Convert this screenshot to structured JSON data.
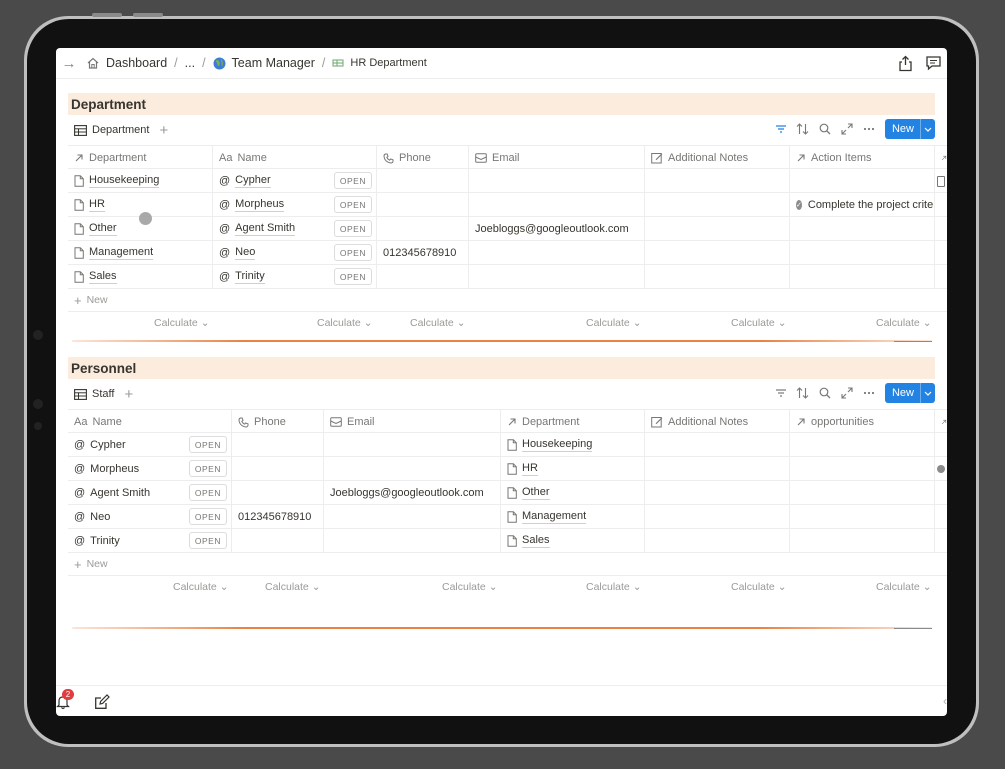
{
  "breadcrumb": {
    "items": [
      "Dashboard",
      "...",
      "Team Manager",
      "HR Department"
    ],
    "separator": "/"
  },
  "colors": {
    "accent": "#2383e2",
    "section_header_bg": "#fbecdd",
    "divider": "#e88344",
    "badge": "#e03e3e"
  },
  "department_section": {
    "title": "Department",
    "view_tab": "Department",
    "new_label": "New",
    "columns": [
      "Department",
      "Name",
      "Phone",
      "Email",
      "Additional Notes",
      "Action Items"
    ],
    "rows": [
      {
        "department": "Housekeeping",
        "name": "Cypher",
        "phone": "",
        "email": "",
        "notes": "",
        "action": ""
      },
      {
        "department": "HR",
        "name": "Morpheus",
        "phone": "",
        "email": "",
        "notes": "",
        "action": "Complete the project criteria"
      },
      {
        "department": "Other",
        "name": "Agent Smith",
        "phone": "",
        "email": "Joebloggs@googleoutlook.com",
        "notes": "",
        "action": ""
      },
      {
        "department": "Management",
        "name": "Neo",
        "phone": "012345678910",
        "email": "",
        "notes": "",
        "action": ""
      },
      {
        "department": "Sales",
        "name": "Trinity",
        "phone": "",
        "email": "",
        "notes": "",
        "action": ""
      }
    ],
    "open_label": "OPEN",
    "add_row_label": "New",
    "calculate_label": "Calculate"
  },
  "personnel_section": {
    "title": "Personnel",
    "view_tab": "Staff",
    "new_label": "New",
    "columns": [
      "Name",
      "Phone",
      "Email",
      "Department",
      "Additional Notes",
      "opportunities"
    ],
    "rows": [
      {
        "name": "Cypher",
        "phone": "",
        "email": "",
        "department": "Housekeeping"
      },
      {
        "name": "Morpheus",
        "phone": "",
        "email": "",
        "department": "HR"
      },
      {
        "name": "Agent Smith",
        "phone": "",
        "email": "Joebloggs@googleoutlook.com",
        "department": "Other"
      },
      {
        "name": "Neo",
        "phone": "012345678910",
        "email": "",
        "department": "Management"
      },
      {
        "name": "Trinity",
        "phone": "",
        "email": "",
        "department": "Sales"
      }
    ],
    "open_label": "OPEN",
    "add_row_label": "New",
    "calculate_label": "Calculate"
  },
  "bottom_bar": {
    "notification_count": "2"
  },
  "icons": [
    "arrow-right-icon",
    "home-icon",
    "globe-icon",
    "sheet-icon",
    "share-icon",
    "comment-icon",
    "table-icon",
    "plus-icon",
    "filter-icon",
    "sort-icon",
    "search-icon",
    "expand-icon",
    "more-icon",
    "chevron-down-icon",
    "page-icon",
    "at-icon",
    "phone-icon",
    "mail-icon",
    "edit-icon",
    "relation-arrow-icon",
    "text-aa-icon",
    "bell-icon",
    "compose-icon",
    "check-circle-icon"
  ]
}
